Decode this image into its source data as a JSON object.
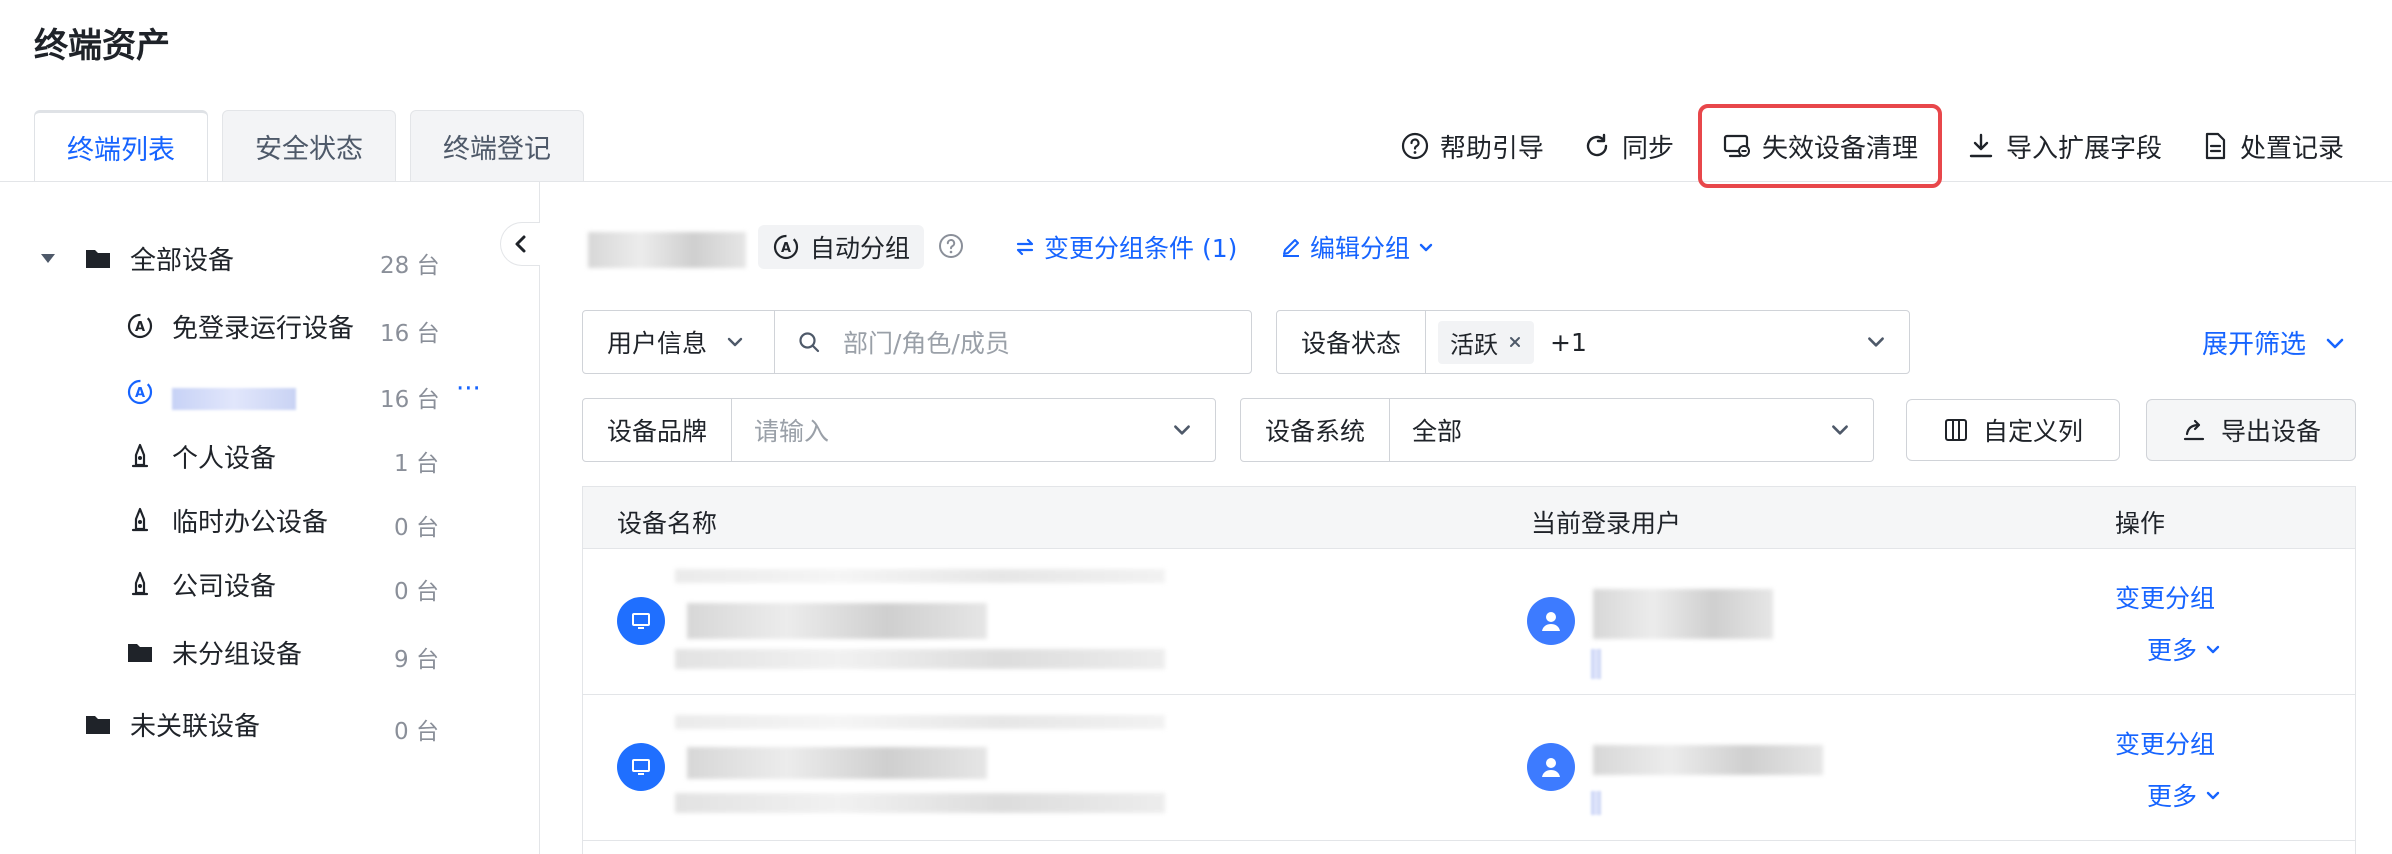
{
  "page_title": "终端资产",
  "tabs": [
    {
      "label": "终端列表",
      "active": true
    },
    {
      "label": "安全状态",
      "active": false
    },
    {
      "label": "终端登记",
      "active": false
    }
  ],
  "top_actions": {
    "help": "帮助引导",
    "sync": "同步",
    "cleanup": "失效设备清理",
    "import": "导入扩展字段",
    "records": "处置记录"
  },
  "sidebar": {
    "all_devices": {
      "label": "全部设备",
      "count": "28 台"
    },
    "items": [
      {
        "label": "免登录运行设备",
        "count": "16 台"
      },
      {
        "label": "",
        "count": "16 台",
        "more": "···"
      },
      {
        "label": "个人设备",
        "count": "1 台"
      },
      {
        "label": "临时办公设备",
        "count": "0 台"
      },
      {
        "label": "公司设备",
        "count": "0 台"
      },
      {
        "label": "未分组设备",
        "count": "9 台"
      }
    ],
    "unlinked": {
      "label": "未关联设备",
      "count": "0 台"
    }
  },
  "group_header": {
    "auto_group": "自动分组",
    "change_condition": "变更分组条件 (1)",
    "edit_group": "编辑分组"
  },
  "filters": {
    "user_info_label": "用户信息",
    "search_placeholder": "部门/角色/成员",
    "status_label": "设备状态",
    "status_tag": "活跃",
    "status_extra": "+1",
    "expand_filter": "展开筛选",
    "brand_label": "设备品牌",
    "brand_placeholder": "请输入",
    "os_label": "设备系统",
    "os_value": "全部",
    "custom_columns": "自定义列",
    "export": "导出设备"
  },
  "table": {
    "headers": [
      "设备名称",
      "当前登录用户",
      "操作"
    ],
    "rows": [
      {
        "op_change": "变更分组",
        "op_more": "更多"
      },
      {
        "op_change": "变更分组",
        "op_more": "更多"
      }
    ]
  },
  "colors": {
    "accent": "#1664ff",
    "highlight_border": "#e8474b"
  }
}
